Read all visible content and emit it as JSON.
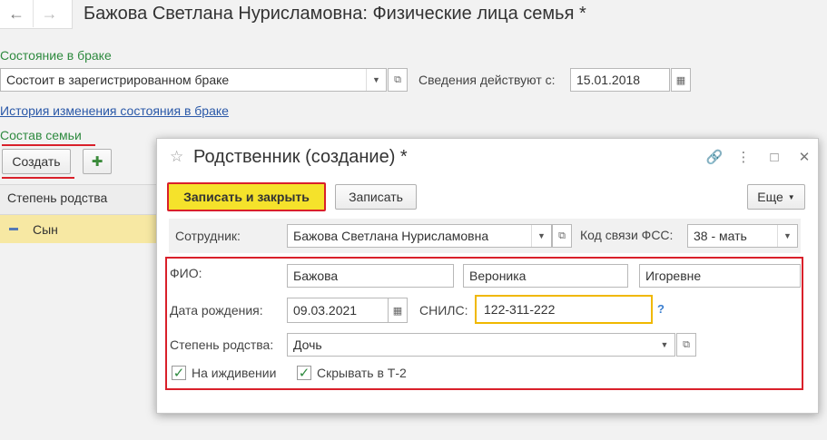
{
  "window": {
    "title": "Бажова Светлана Нурисламовна: Физические лица семья *",
    "back_icon": "arrow-left-icon",
    "forward_icon": "arrow-right-icon"
  },
  "marital": {
    "label": "Состояние в браке",
    "value": "Состоит в зарегистрированном браке",
    "valid_from_label": "Сведения действуют с:",
    "valid_from_value": "15.01.2018",
    "history_link": "История изменения состояния в браке"
  },
  "family": {
    "section_label": "Состав семьи",
    "create_button": "Создать",
    "column_header": "Степень родства",
    "rows": [
      {
        "relation": "Сын"
      }
    ]
  },
  "dialog": {
    "title": "Родственник (создание) *",
    "save_close_button": "Записать и закрыть",
    "save_button": "Записать",
    "more_button": "Еще",
    "employee_label": "Сотрудник:",
    "employee_value": "Бажова Светлана Нурисламовна",
    "fss_code_label": "Код связи ФСС:",
    "fss_code_value": "38 - мать",
    "fio_label": "ФИО:",
    "last_name": "Бажова",
    "first_name": "Вероника",
    "patronymic": "Игоревне",
    "birth_label": "Дата рождения:",
    "birth_value": "09.03.2021",
    "snils_label": "СНИЛС:",
    "snils_value": "122-311-222",
    "help_mark": "?",
    "relation_label": "Степень родства:",
    "relation_value": "Дочь",
    "dependent_label": "На иждивении",
    "dependent_checked": true,
    "hide_t2_label": "Скрывать в Т-2",
    "hide_t2_checked": true
  },
  "colors": {
    "accent_green": "#2e8a3f",
    "link_blue": "#2a58a8",
    "highlight_red": "#d9202a",
    "primary_button_yellow": "#f5e22b",
    "active_field_border": "#f0b800",
    "selected_row": "#f7e8a3"
  }
}
